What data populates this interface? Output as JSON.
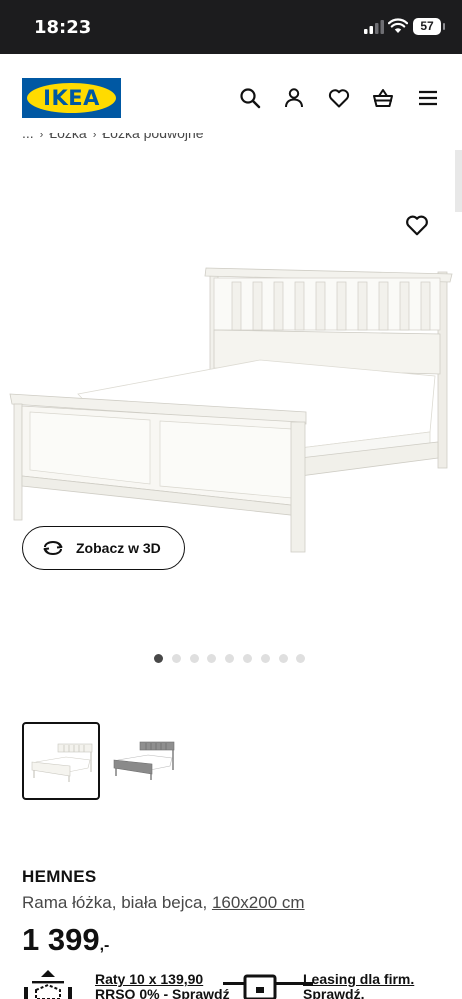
{
  "status_bar": {
    "time": "18:23",
    "battery": "57"
  },
  "header": {
    "logo_text": "IKEA",
    "icons": [
      "search-icon",
      "account-icon",
      "heart-icon",
      "basket-icon",
      "menu-icon"
    ]
  },
  "breadcrumb": {
    "items": [
      "...",
      "Łóżka",
      "Łóżka podwójne"
    ],
    "separator": "›"
  },
  "gallery": {
    "view3d_label": "Zobacz w 3D",
    "dot_count": 9,
    "active_dot": 0,
    "thumbnails": [
      "white",
      "grey"
    ]
  },
  "product": {
    "name": "HEMNES",
    "description": "Rama łóżka, biała bejca, ",
    "size": "160x200 cm",
    "price": "1 399",
    "price_suffix": ",-"
  },
  "promos": [
    {
      "line1": "Raty 10 x 139,90",
      "line2": "RRSO 0% - Sprawdź"
    },
    {
      "line1": "Leasing dla firm.",
      "line2": "Sprawdź."
    }
  ],
  "colors": {
    "ikea_blue": "#0058a3",
    "ikea_yellow": "#ffdb00",
    "status_bar_bg": "#1c1c1e"
  }
}
